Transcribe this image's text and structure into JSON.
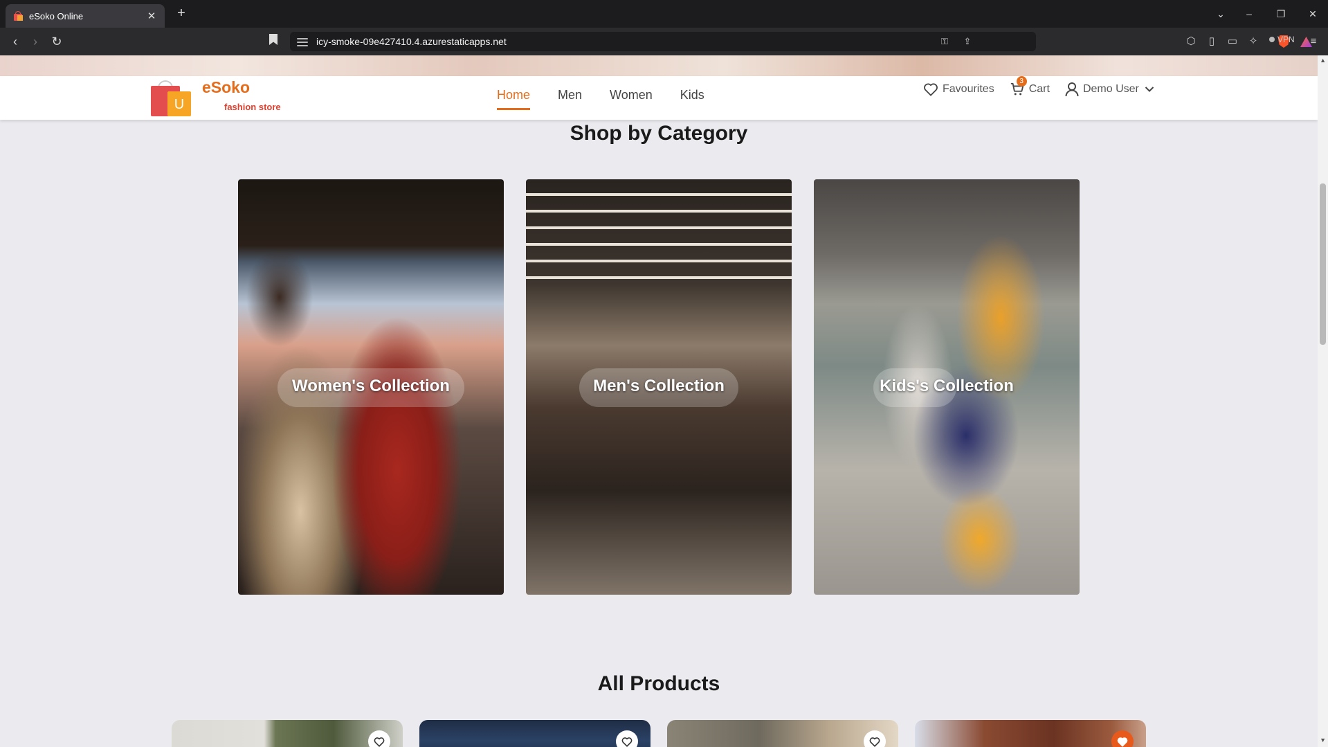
{
  "browser": {
    "tab_title": "eSoko Online",
    "url": "icy-smoke-09e427410.4.azurestaticapps.net",
    "vpn_label": "VPN"
  },
  "site": {
    "brand_name": "eSoko",
    "brand_tagline": "fashion store",
    "nav": [
      "Home",
      "Men",
      "Women",
      "Kids"
    ],
    "active_nav": "Home",
    "favourites_label": "Favourites",
    "cart_label": "Cart",
    "cart_count": "3",
    "user_label": "Demo User",
    "accent_color": "#e46d1c"
  },
  "categories": {
    "title": "Shop by Category",
    "items": [
      {
        "label": "Women's Collection"
      },
      {
        "label": "Men's Collection"
      },
      {
        "label": "Kids's Collection"
      }
    ]
  },
  "products": {
    "title": "All Products",
    "cards": [
      {
        "favorited": false
      },
      {
        "favorited": false
      },
      {
        "favorited": false
      },
      {
        "favorited": true
      }
    ]
  }
}
